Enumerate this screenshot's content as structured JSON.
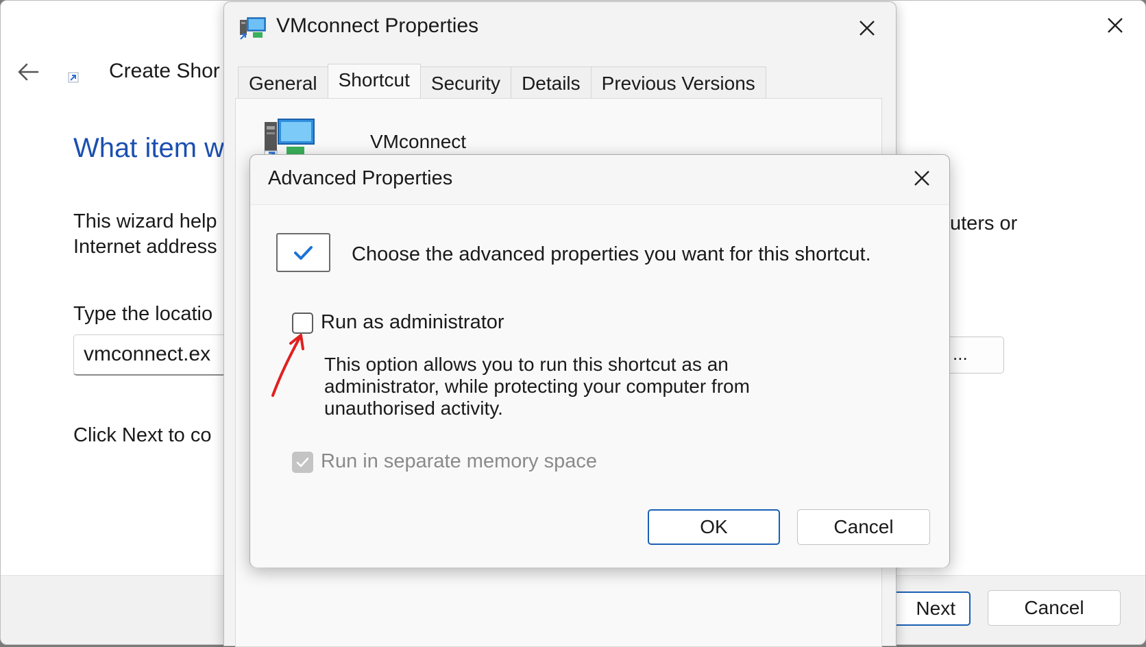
{
  "wizard": {
    "title": "Create Shor",
    "heading": "What item w",
    "description_line1": "This wizard help",
    "description_line2": "Internet address",
    "description_right": "uters or",
    "type_label": "Type the locatio",
    "location_value": "vmconnect.ex",
    "browse_label": "...",
    "click_next_text": "Click Next to co",
    "next_label": "Next",
    "cancel_label": "Cancel"
  },
  "properties": {
    "title": "VMconnect Properties",
    "tabs": [
      {
        "label": "General"
      },
      {
        "label": "Shortcut"
      },
      {
        "label": "Security"
      },
      {
        "label": "Details"
      },
      {
        "label": "Previous Versions"
      }
    ],
    "active_tab": "Shortcut",
    "shortcut_name": "VMconnect"
  },
  "advanced": {
    "title": "Advanced Properties",
    "intro": "Choose the advanced properties you want for this shortcut.",
    "run_as_admin": {
      "label": "Run as administrator",
      "checked": false
    },
    "description_lines": [
      "This option allows you to run this shortcut as an",
      "administrator, while protecting your computer from",
      "unauthorised activity."
    ],
    "separate_memory": {
      "label": "Run in separate memory space",
      "checked": true,
      "disabled": true
    },
    "ok_label": "OK",
    "cancel_label": "Cancel"
  },
  "colors": {
    "accent": "#1a5fb4",
    "heading_blue": "#1b4fb0",
    "annotation_red": "#e02020"
  },
  "icons": [
    "close-icon",
    "back-arrow-icon",
    "shortcut-icon",
    "vmconnect-icon",
    "checkmark-icon",
    "annotation-arrow-icon"
  ]
}
